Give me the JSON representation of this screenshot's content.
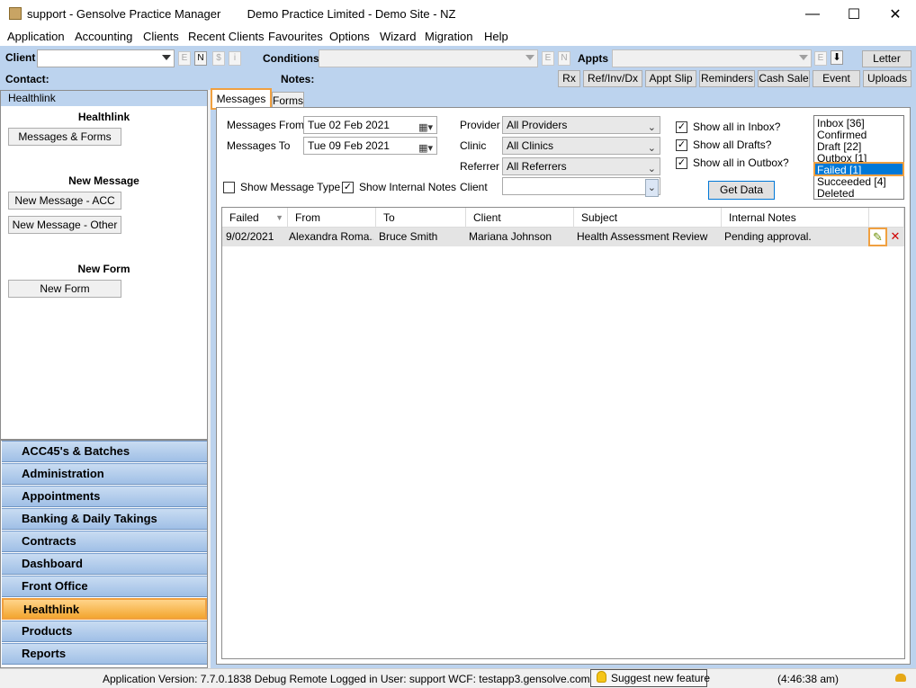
{
  "window": {
    "title": "support - Gensolve Practice Manager",
    "subtitle": "Demo Practice Limited  - Demo Site - NZ",
    "minimize": "—",
    "maximize": "☐",
    "close": "✕"
  },
  "menu": [
    "Application",
    "Accounting",
    "Clients",
    "Recent Clients",
    "Favourites",
    "Options",
    "Wizard",
    "Migration",
    "Help"
  ],
  "toolbar": {
    "client_label": "Client",
    "contact_label": "Contact:",
    "conditions_label": "Conditions",
    "notes_label": "Notes:",
    "appts_label": "Appts",
    "mini_e": "E",
    "mini_n": "N",
    "mini_dollar": "$",
    "mini_i": "i",
    "mini_down": "⬇",
    "letter": "Letter",
    "buttons": [
      "Rx",
      "Ref/Inv/Dx",
      "Appt Slip",
      "Reminders",
      "Cash Sale",
      "Event",
      "Uploads"
    ]
  },
  "left": {
    "header": "Healthlink",
    "section1": "Healthlink",
    "btn_messages_forms": "Messages & Forms",
    "section2": "New Message",
    "btn_new_acc": "New Message - ACC",
    "btn_new_other": "New Message - Other",
    "section3": "New Form",
    "btn_new_form": "New Form"
  },
  "nav": [
    "ACC45's & Batches",
    "Administration",
    "Appointments",
    "Banking & Daily Takings",
    "Contracts",
    "Dashboard",
    "Front Office",
    "Healthlink",
    "Products",
    "Reports"
  ],
  "tabs": {
    "messages": "Messages",
    "forms": "Forms"
  },
  "filters": {
    "messages_from_label": "Messages From",
    "messages_from_value": "Tue  02 Feb  2021",
    "messages_to_label": "Messages To",
    "messages_to_value": "Tue  09 Feb  2021",
    "provider_label": "Provider",
    "provider_value": "All Providers",
    "clinic_label": "Clinic",
    "clinic_value": "All Clinics",
    "referrer_label": "Referrer",
    "referrer_value": "All Referrers",
    "client_label": "Client",
    "client_value": "",
    "show_inbox": "Show all in Inbox?",
    "show_drafts": "Show all Drafts?",
    "show_outbox": "Show all in Outbox?",
    "show_message_type": "Show Message Type",
    "show_internal_notes": "Show Internal Notes",
    "get_data": "Get Data",
    "checkmark": "✓"
  },
  "status_list": [
    "Inbox  [36]",
    "Confirmed",
    "Draft  [22]",
    "Outbox  [1]",
    "Failed  [1]",
    "Succeeded  [4]",
    "Deleted"
  ],
  "grid": {
    "columns": [
      "Failed",
      "From",
      "To",
      "Client",
      "Subject",
      "Internal Notes"
    ],
    "rows": [
      {
        "failed": "9/02/2021",
        "from": "Alexandra Roma...",
        "to": "Bruce Smith",
        "client": "Mariana Johnson",
        "subject": "Health Assessment Review",
        "notes": "Pending approval."
      }
    ],
    "edit_icon": "✎",
    "delete_icon": "✕"
  },
  "status": {
    "version": "Application Version: 7.7.0.1838 Debug Remote  Logged in User: support WCF: testapp3.gensolve.com:4551",
    "suggest": "Suggest new feature",
    "time": "(4:46:38 am)"
  },
  "colors": {
    "accent_blue": "#bcd3ee",
    "highlight_orange": "#f0a040",
    "selection": "#0078d7"
  }
}
